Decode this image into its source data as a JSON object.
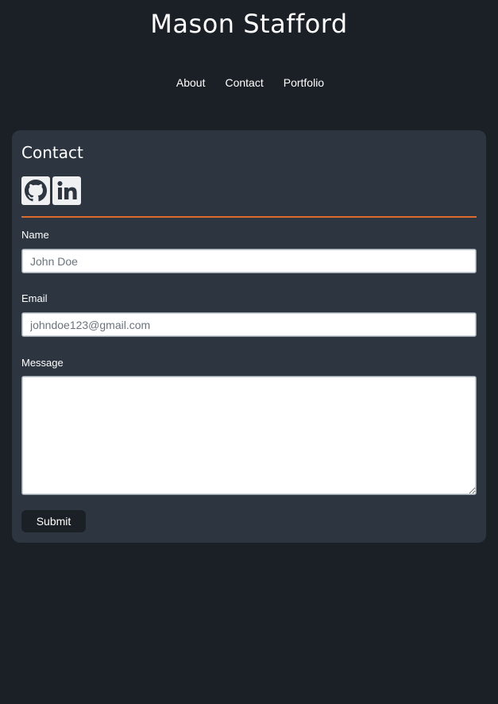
{
  "header": {
    "title": "Mason Stafford"
  },
  "nav": {
    "items": [
      {
        "label": "About"
      },
      {
        "label": "Contact"
      },
      {
        "label": "Portfolio"
      }
    ]
  },
  "contact": {
    "title": "Contact",
    "social": [
      {
        "icon": "github-icon"
      },
      {
        "icon": "linkedin-icon"
      }
    ],
    "divider_color": "#dd6b2c",
    "fields": {
      "name": {
        "label": "Name",
        "placeholder": "John Doe",
        "value": ""
      },
      "email": {
        "label": "Email",
        "placeholder": "johndoe123@gmail.com",
        "value": ""
      },
      "message": {
        "label": "Message",
        "value": ""
      }
    },
    "submit_label": "Submit"
  },
  "colors": {
    "page_background": "#1b1f26",
    "card_background": "#2c3540",
    "accent": "#dd6b2c"
  }
}
